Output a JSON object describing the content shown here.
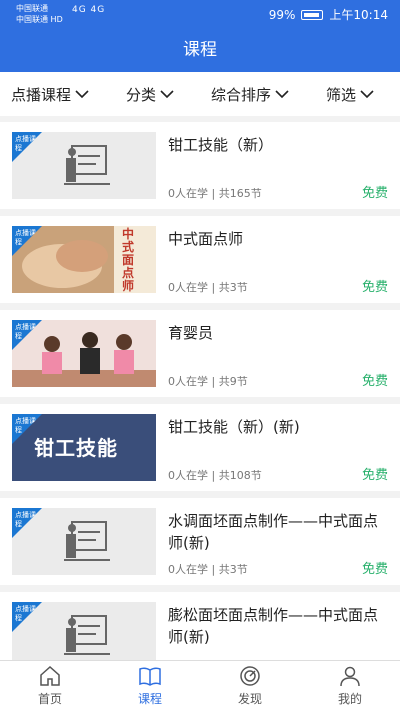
{
  "status": {
    "carrier1": "中国联通",
    "carrier2": "中国联通",
    "hd": "HD",
    "signal": "4G 4G",
    "battery_pct": "99%",
    "time": "上午10:14"
  },
  "header": {
    "title": "课程"
  },
  "filters": [
    {
      "label": "点播课程"
    },
    {
      "label": "分类"
    },
    {
      "label": "综合排序"
    },
    {
      "label": "筛选"
    }
  ],
  "badge_text": "点播课程",
  "courses": [
    {
      "title": "钳工技能（新）",
      "meta": "0人在学 | 共165节",
      "price": "免费",
      "thumb": "placeholder"
    },
    {
      "title": "中式面点师",
      "meta": "0人在学 | 共3节",
      "price": "免费",
      "thumb": "pastry"
    },
    {
      "title": "育婴员",
      "meta": "0人在学 | 共9节",
      "price": "免费",
      "thumb": "nursery"
    },
    {
      "title": "钳工技能（新）(新)",
      "meta": "0人在学 | 共108节",
      "price": "免费",
      "thumb": "banner",
      "thumb_text": "钳工技能"
    },
    {
      "title": "水调面坯面点制作——中式面点师(新)",
      "meta": "0人在学 | 共3节",
      "price": "免费",
      "thumb": "placeholder"
    },
    {
      "title": "膨松面坯面点制作——中式面点师(新)",
      "meta": "",
      "price": "",
      "thumb": "placeholder"
    }
  ],
  "pastry_text": "中式面点师",
  "tabs": [
    {
      "label": "首页",
      "icon": "home-icon"
    },
    {
      "label": "课程",
      "icon": "book-icon"
    },
    {
      "label": "发现",
      "icon": "discover-icon"
    },
    {
      "label": "我的",
      "icon": "user-icon"
    }
  ],
  "colors": {
    "primary": "#2f6fe0",
    "free": "#27b06b",
    "badge": "#1b77d2"
  }
}
